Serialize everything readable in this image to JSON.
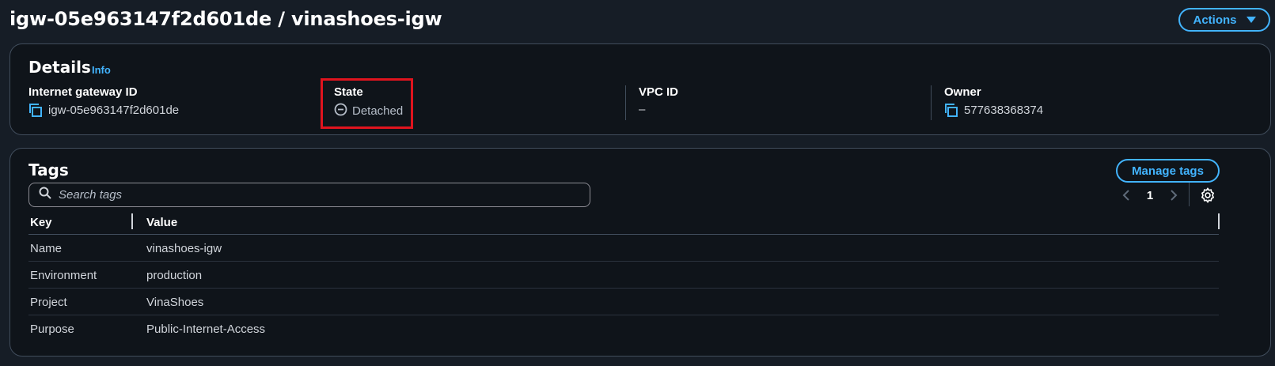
{
  "header": {
    "title": "igw-05e963147f2d601de / vinashoes-igw",
    "actions_label": "Actions"
  },
  "details": {
    "title": "Details",
    "info_label": "Info",
    "internet_gateway_id": {
      "label": "Internet gateway ID",
      "value": "igw-05e963147f2d601de"
    },
    "state": {
      "label": "State",
      "value": "Detached"
    },
    "vpc_id": {
      "label": "VPC ID",
      "value": "–"
    },
    "owner": {
      "label": "Owner",
      "value": "577638368374"
    }
  },
  "tags": {
    "title": "Tags",
    "manage_label": "Manage tags",
    "search_placeholder": "Search tags",
    "page": "1",
    "columns": {
      "key": "Key",
      "value": "Value"
    },
    "rows": [
      {
        "key": "Name",
        "value": "vinashoes-igw"
      },
      {
        "key": "Environment",
        "value": "production"
      },
      {
        "key": "Project",
        "value": "VinaShoes"
      },
      {
        "key": "Purpose",
        "value": "Public-Internet-Access"
      }
    ]
  },
  "colors": {
    "background": "#161d26",
    "card": "#0f141a",
    "accent": "#42b4ff",
    "highlight": "#e0141e"
  }
}
